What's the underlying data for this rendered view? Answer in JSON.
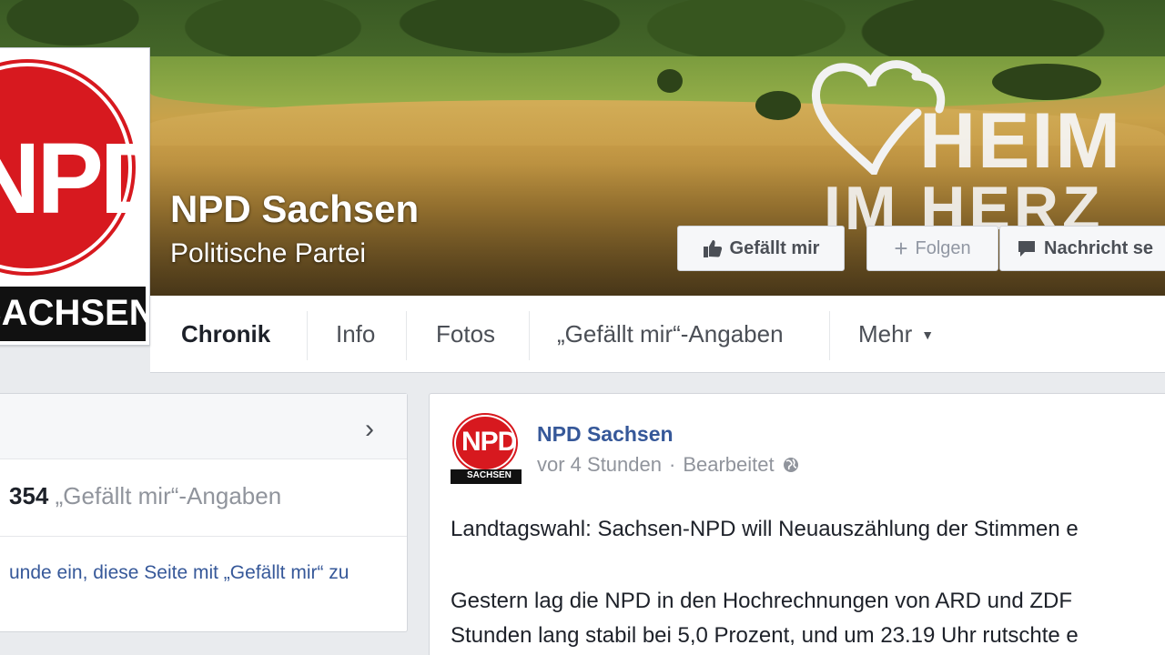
{
  "page": {
    "name": "NPD Sachsen",
    "category": "Politische Partei"
  },
  "cover": {
    "slogan_line1": "HEIM",
    "slogan_line2": "IM HERZ"
  },
  "profile_picture": {
    "logo_text": "NPD",
    "banner_text": "SACHSEN"
  },
  "actions": {
    "like_label": "Gefällt mir",
    "follow_label": "Folgen",
    "message_label": "Nachricht se"
  },
  "nav": {
    "tabs": [
      {
        "label": "Chronik",
        "active": true
      },
      {
        "label": "Info"
      },
      {
        "label": "Fotos"
      },
      {
        "label": "„Gefällt mir“-Angaben"
      },
      {
        "label": "Mehr"
      }
    ]
  },
  "sidebar": {
    "likes_count": "354",
    "likes_label": "„Gefällt mir“-Angaben",
    "invite_text": "unde ein, diese Seite mit „Gefällt mir“ zu"
  },
  "post": {
    "author": "NPD Sachsen",
    "time": "vor 4 Stunden",
    "separator": "·",
    "edited": "Bearbeitet",
    "line1": "Landtagswahl: Sachsen-NPD will Neuauszählung der Stimmen e",
    "line2": "Gestern lag die NPD in den Hochrechnungen von ARD und ZDF",
    "line3": "Stunden lang stabil bei 5,0 Prozent, und um 23.19 Uhr rutschte e"
  },
  "colors": {
    "link_blue": "#365899",
    "active_tab_underline": "#4267b2",
    "npd_red": "#d7191f"
  },
  "icons": {
    "like": "thumbs-up-icon",
    "follow": "plus-icon",
    "message": "speech-bubble-icon",
    "more": "caret-down-icon",
    "sidebar": "chevron-right-icon",
    "privacy": "globe-icon"
  }
}
